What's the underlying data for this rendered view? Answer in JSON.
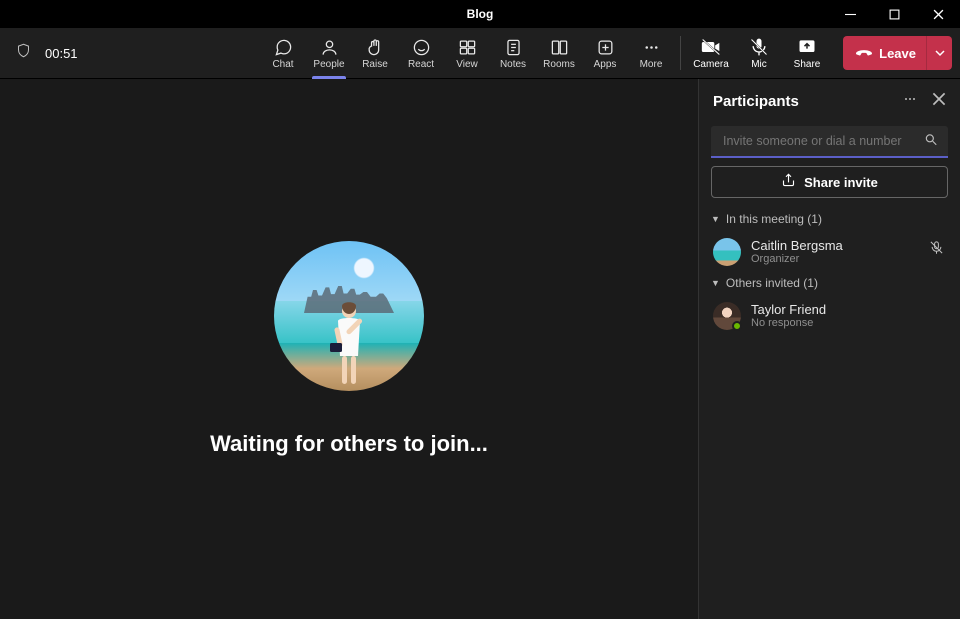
{
  "window": {
    "title": "Blog"
  },
  "timer": "00:51",
  "toolbar": {
    "chat": "Chat",
    "people": "People",
    "raise": "Raise",
    "react": "React",
    "view": "View",
    "notes": "Notes",
    "rooms": "Rooms",
    "apps": "Apps",
    "more": "More",
    "camera": "Camera",
    "mic": "Mic",
    "share": "Share",
    "leave": "Leave"
  },
  "stage": {
    "waiting_text": "Waiting for others to join..."
  },
  "panel": {
    "title": "Participants",
    "search_placeholder": "Invite someone or dial a number",
    "share_invite": "Share invite",
    "sections": {
      "in_meeting": {
        "label": "In this meeting (1)"
      },
      "invited": {
        "label": "Others invited (1)"
      }
    },
    "in_meeting_list": [
      {
        "name": "Caitlin Bergsma",
        "subtitle": "Organizer",
        "mic_muted": true
      }
    ],
    "invited_list": [
      {
        "name": "Taylor Friend",
        "subtitle": "No response",
        "presence": "available"
      }
    ]
  },
  "colors": {
    "accent": "#5b5fc7",
    "danger": "#c4314b"
  }
}
